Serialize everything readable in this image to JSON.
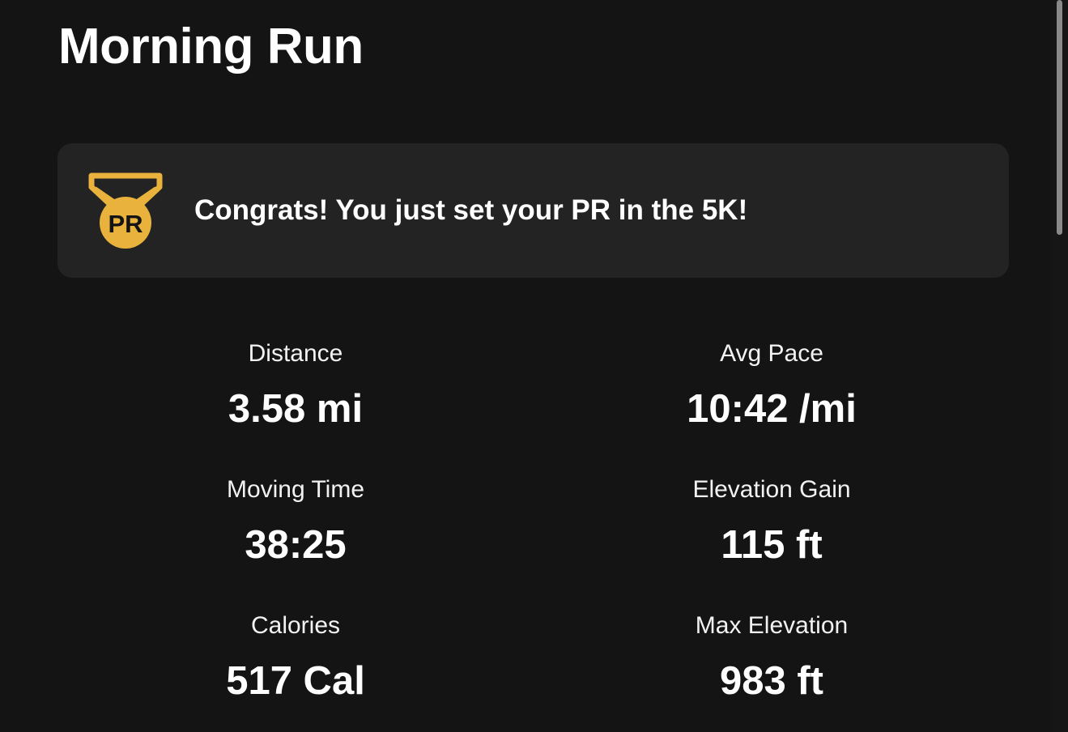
{
  "activity": {
    "title": "Morning Run"
  },
  "pr_banner": {
    "icon": "pr-medal-icon",
    "icon_text": "PR",
    "message": "Congrats! You just set your PR in the 5K!",
    "accent_color": "#e9b23c"
  },
  "stats": [
    {
      "label": "Distance",
      "value": "3.58 mi"
    },
    {
      "label": "Avg Pace",
      "value": "10:42 /mi"
    },
    {
      "label": "Moving Time",
      "value": "38:25"
    },
    {
      "label": "Elevation Gain",
      "value": "115 ft"
    },
    {
      "label": "Calories",
      "value": "517 Cal"
    },
    {
      "label": "Max Elevation",
      "value": "983 ft"
    }
  ],
  "theme": {
    "background": "#141414",
    "card": "#232323",
    "text": "#ffffff"
  }
}
